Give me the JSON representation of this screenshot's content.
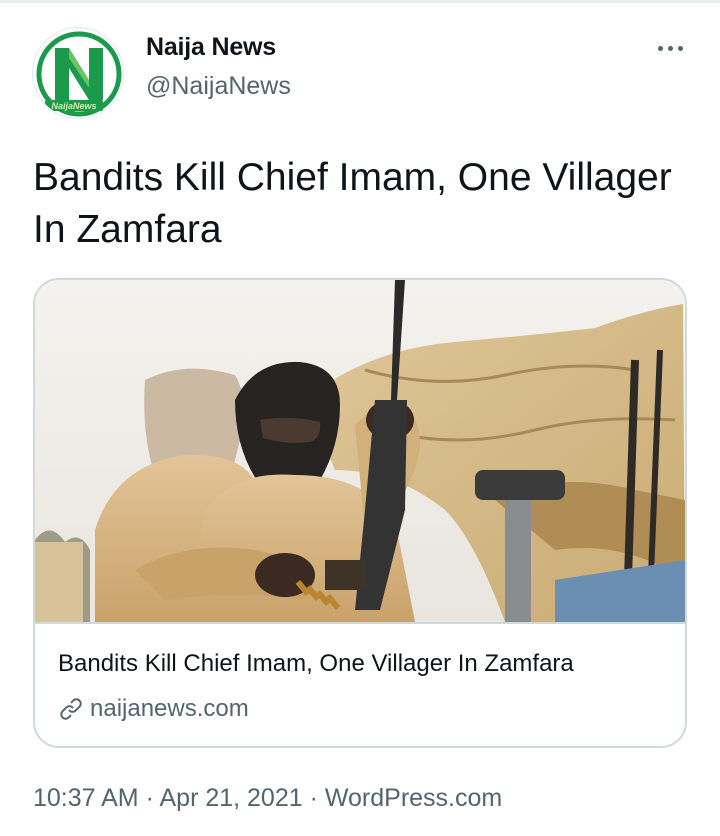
{
  "author": {
    "display_name": "Naija News",
    "handle": "@NaijaNews",
    "avatar_text": "NaijaNews"
  },
  "tweet": {
    "text": "Bandits Kill Chief Imam, One Villager In Zamfara"
  },
  "card": {
    "title": "Bandits Kill Chief Imam, One Villager In Zamfara",
    "domain": "naijanews.com",
    "link_icon": "link-icon"
  },
  "meta": {
    "time": "10:37 AM",
    "separator": " · ",
    "date": "Apr 21, 2021",
    "source": "WordPress.com"
  },
  "colors": {
    "text_primary": "#0f1419",
    "text_secondary": "#536471",
    "border": "#cfd9de",
    "brand_green": "#1a9a4a"
  }
}
